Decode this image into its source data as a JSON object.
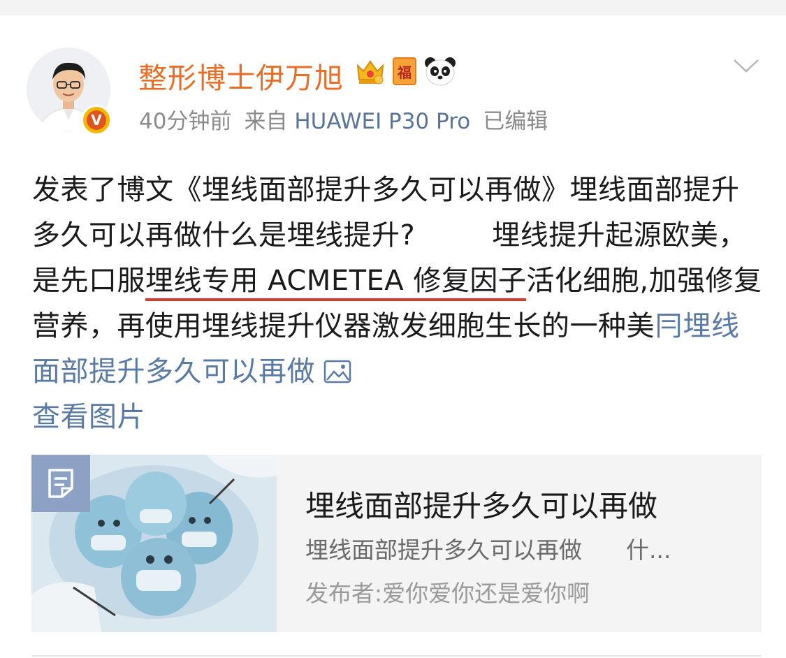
{
  "post": {
    "author": {
      "name": "整形博士伊万旭",
      "verified_badge": "V"
    },
    "badges": {
      "fu_label": "福"
    },
    "meta": {
      "time": "40分钟前",
      "from": "来自",
      "device": "HUAWEI P30 Pro",
      "edited": "已编辑"
    },
    "content": {
      "part1": "发表了博文《埋线面部提升多久可以再做》埋线面部提升多久可以再做什么是埋线提升?",
      "part2": "埋线提升起源欧美，是先口服",
      "underlined": "埋线专用 ACMETEA 修复因子",
      "part3": "活化细胞,加强修复营养，再使用埋线提升仪器激发细胞生长的一种美",
      "link_glyph": "冃",
      "link_title": "埋线面部提升多久可以再做",
      "view_images": "查看图片"
    },
    "card": {
      "title": "埋线面部提升多久可以再做",
      "description": "埋线面部提升多久可以再做      什...",
      "author": "发布者:爱你爱你还是爱你啊"
    }
  },
  "colors": {
    "username": "#e96d25",
    "link": "#5a7aa6",
    "underline": "#d63c2f",
    "meta": "#8b8b8b"
  }
}
